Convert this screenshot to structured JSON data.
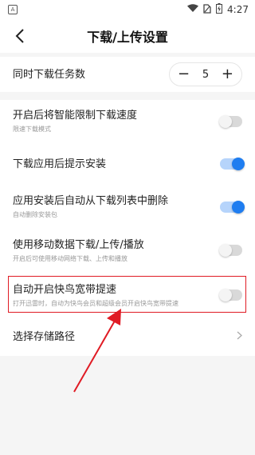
{
  "status_bar": {
    "time": "4:27",
    "app_icon_letter": "A"
  },
  "header": {
    "title": "下载/上传设置"
  },
  "settings": {
    "concurrent": {
      "label": "同时下载任务数",
      "value": "5",
      "minus": "−",
      "plus": "+"
    },
    "smart_limit": {
      "title": "开启后将智能限制下载速度",
      "subtitle": "限速下载模式",
      "enabled": false
    },
    "prompt_install": {
      "title": "下载应用后提示安装",
      "enabled": true
    },
    "auto_delete": {
      "title": "应用安装后自动从下载列表中删除",
      "subtitle": "自动删除安装包",
      "enabled": true
    },
    "mobile_data": {
      "title": "使用移动数据下载/上传/播放",
      "subtitle": "开启后可使用移动网络下载、上传和播放",
      "enabled": false
    },
    "acceleration": {
      "title": "自动开启快鸟宽带提速",
      "subtitle": "打开迅雷时，自动为快鸟会员和超级会员开启快鸟宽带提速",
      "enabled": false
    },
    "storage_path": {
      "title": "选择存储路径"
    }
  },
  "colors": {
    "accent": "#1f7df0",
    "highlight": "#e01b24"
  }
}
